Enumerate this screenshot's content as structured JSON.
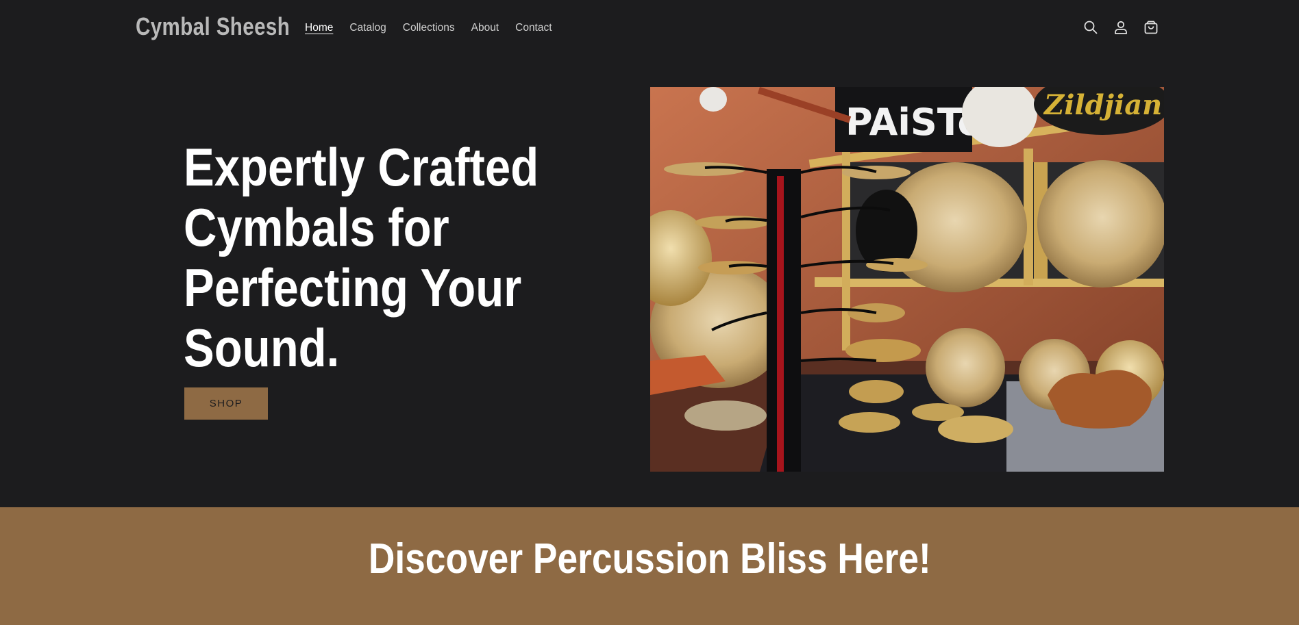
{
  "header": {
    "logo": "Cymbal Sheesh",
    "nav": [
      {
        "label": "Home",
        "active": true
      },
      {
        "label": "Catalog"
      },
      {
        "label": "Collections"
      },
      {
        "label": "About"
      },
      {
        "label": "Contact"
      }
    ],
    "icons": [
      "search-icon",
      "account-icon",
      "cart-icon"
    ]
  },
  "hero": {
    "title": "Expertly Crafted Cymbals for Perfecting Your Sound.",
    "button_label": "SHOP",
    "image_logos": [
      "PAiSTe",
      "Zildjian"
    ]
  },
  "banner": {
    "title": "Discover Percussion Bliss Here!"
  },
  "colors": {
    "background": "#1c1c1e",
    "accent": "#8e6a44",
    "text": "#ffffff"
  }
}
